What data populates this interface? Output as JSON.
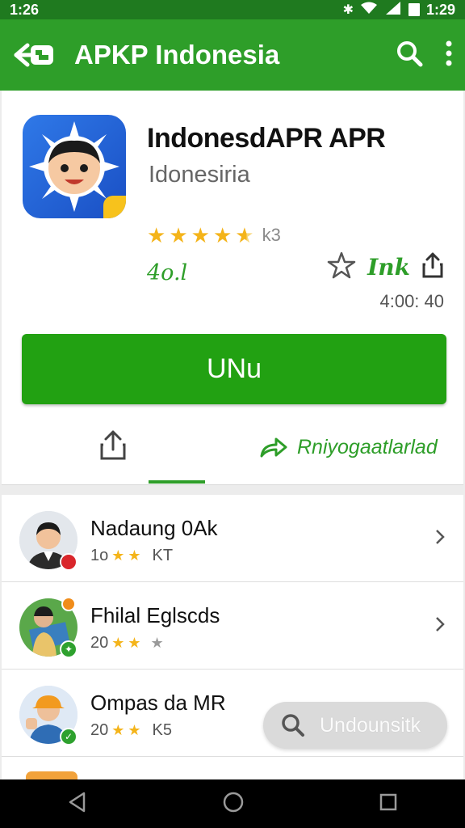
{
  "status_bar": {
    "time_left": "1:26",
    "time_right": "1:29"
  },
  "app_bar": {
    "title": "APKP Indonesia"
  },
  "app": {
    "name": "IndonesdAPR APR",
    "developer": "Idonesiria",
    "rating_count": "k3",
    "downloads": "4o.l",
    "link_label": "Ink",
    "time": "4:00: 40",
    "install_label": "UNu",
    "forward_label": "Rniyogaatlarlad",
    "rating_stars": 4.5
  },
  "list": {
    "items": [
      {
        "title": "Nadaung 0Ak",
        "rating": "1o",
        "extra": "KT",
        "badge_color": "#d9262b"
      },
      {
        "title": "Fhilal Eglscds",
        "rating": "20",
        "extra": "",
        "badge_color": "#2ea12e"
      },
      {
        "title": "Ompas da MR",
        "rating": "20",
        "extra": "K5",
        "badge_color": "#2ea12e"
      }
    ]
  },
  "search_fab": {
    "label": "Undounsitk"
  }
}
